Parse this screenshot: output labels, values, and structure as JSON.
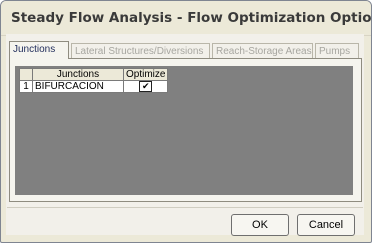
{
  "window": {
    "title": "Steady Flow Analysis - Flow Optimization Options"
  },
  "tabs": [
    {
      "label": "Junctions",
      "active": true
    },
    {
      "label": "Lateral Structures/Diversions",
      "active": false
    },
    {
      "label": "Reach-Storage Areas",
      "active": false
    },
    {
      "label": "Pumps",
      "active": false
    }
  ],
  "grid": {
    "columns": [
      "Junctions",
      "Optimize"
    ],
    "rows": [
      {
        "row_number": "1",
        "junction": "BIFURCACION",
        "optimize": true,
        "optimize_mark": "✔"
      }
    ]
  },
  "buttons": {
    "ok": "OK",
    "cancel": "Cancel"
  }
}
